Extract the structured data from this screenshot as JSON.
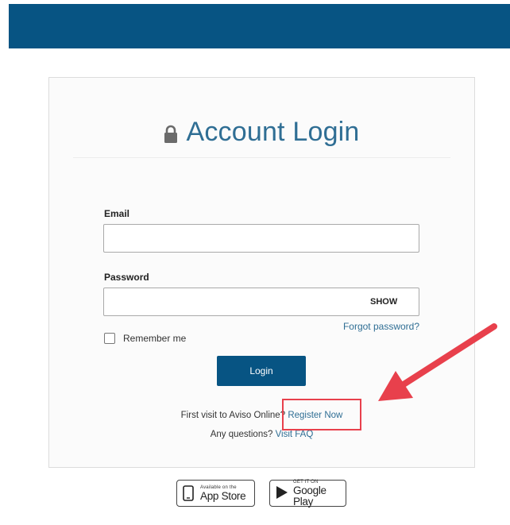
{
  "header": {
    "bar_color": "#075483"
  },
  "login_card": {
    "title": "Account Login",
    "title_icon": "lock-icon",
    "email": {
      "label": "Email",
      "value": "",
      "placeholder": ""
    },
    "password": {
      "label": "Password",
      "value": "",
      "placeholder": "",
      "show_label": "SHOW"
    },
    "forgot_password_label": "Forgot password?",
    "remember_me_label": "Remember me",
    "remember_me_checked": false,
    "login_button_label": "Login",
    "first_visit_text": "First visit to Aviso Online?",
    "register_link_label": "Register Now",
    "questions_text": "Any questions?",
    "faq_link_label": "Visit FAQ"
  },
  "annotation": {
    "highlight_color": "#e8404c",
    "arrow_icon": "arrow-icon"
  },
  "store_badges": {
    "app_store": {
      "small_text": "Available on the",
      "large_text": "App Store",
      "icon": "phone-icon"
    },
    "google_play": {
      "small_text": "GET IT ON",
      "large_text": "Google Play",
      "icon": "play-icon"
    }
  },
  "colors": {
    "primary": "#075483",
    "link": "#2f6e94",
    "title": "#2f6e94",
    "annotation": "#e8404c"
  }
}
